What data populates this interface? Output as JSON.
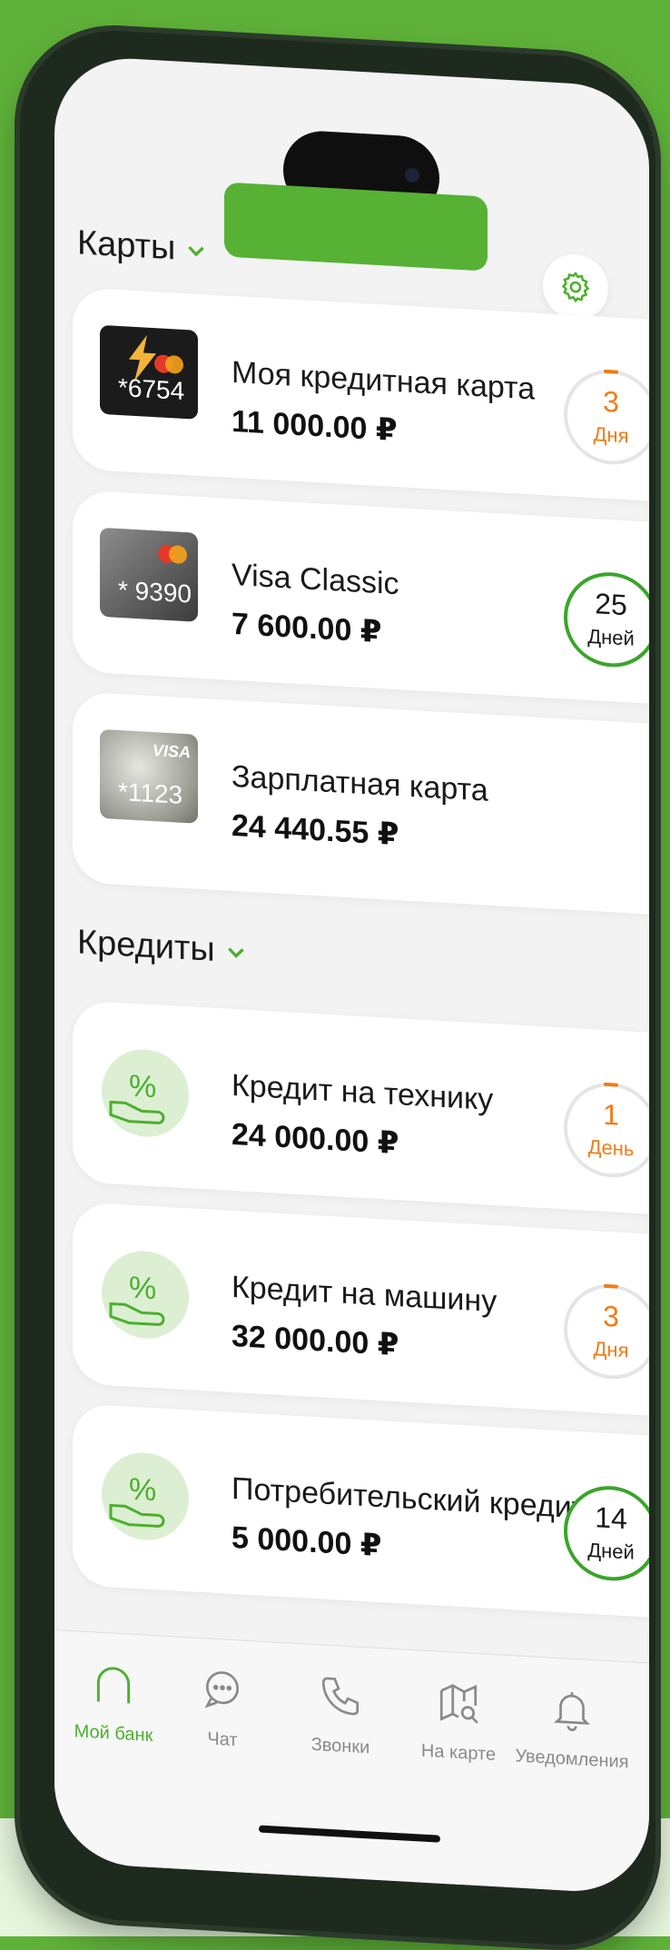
{
  "colors": {
    "brand_green": "#57b135",
    "accent_orange": "#f07c1a",
    "screen_bg": "#f2f3f2"
  },
  "header": {
    "settings_icon": "gear-icon"
  },
  "cards_section": {
    "title": "Карты",
    "add_icon": "plus-icon"
  },
  "cards": [
    {
      "name": "Моя кредитная карта",
      "amount": "11 000.00 ₽",
      "last4": "*6754",
      "days_num": "3",
      "days_unit": "Дня",
      "state": "orange"
    },
    {
      "name": "Visa Classic",
      "amount": "7 600.00 ₽",
      "last4": "* 9390",
      "days_num": "25",
      "days_unit": "Дней",
      "state": "green"
    },
    {
      "name": "Зарплатная карта",
      "amount": "24 440.55 ₽",
      "last4": "*1123",
      "brand": "VISA"
    }
  ],
  "credits_section": {
    "title": "Кредиты",
    "add_icon": "plus-icon"
  },
  "credits": [
    {
      "name": "Кредит на технику",
      "amount": "24 000.00 ₽",
      "days_num": "1",
      "days_unit": "День",
      "state": "orange"
    },
    {
      "name": "Кредит на машину",
      "amount": "32 000.00 ₽",
      "days_num": "3",
      "days_unit": "Дня",
      "state": "orange"
    },
    {
      "name": "Потребительский кредит",
      "amount": "5 000.00 ₽",
      "days_num": "14",
      "days_unit": "Дней",
      "state": "green"
    }
  ],
  "tabbar": {
    "items": [
      {
        "label": "Мой банк",
        "icon": "bank-icon",
        "active": true
      },
      {
        "label": "Чат",
        "icon": "chat-icon"
      },
      {
        "label": "Звонки",
        "icon": "phone-icon"
      },
      {
        "label": "На карте",
        "icon": "map-search-icon"
      },
      {
        "label": "Уведомления",
        "icon": "bell-icon"
      }
    ]
  }
}
